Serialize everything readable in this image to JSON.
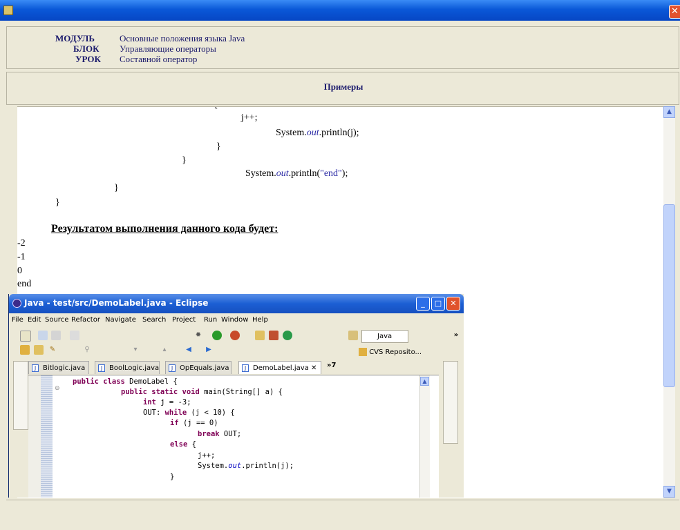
{
  "window": {
    "close_glyph": "✕"
  },
  "header": {
    "module_label": "МОДУЛЬ",
    "module_value": "Основные положения языка Java",
    "block_label": "БЛОК",
    "block_value": "Управляющие операторы",
    "lesson_label": "УРОК",
    "lesson_value": "Составной оператор"
  },
  "examples_title": "Примеры",
  "code": {
    "line_top": "{",
    "line1": "j++;",
    "line2a": "System.",
    "line2b": "out",
    "line2c": ".println(j);",
    "line3": "}",
    "line4": "}",
    "line5a": "System.",
    "line5b": "out",
    "line5c": ".println(",
    "line5d": "\"end\"",
    "line5e": ");",
    "line6": "}",
    "line7": "}"
  },
  "result_heading": "Результатом выполнения данного кода будет:",
  "output": [
    "-2",
    "-1",
    "0",
    "end"
  ],
  "eclipse": {
    "title": "Java - test/src/DemoLabel.java - Eclipse",
    "menu": [
      "File",
      "Edit",
      "Source",
      "Refactor",
      "Navigate",
      "Search",
      "Project",
      "Run",
      "Window",
      "Help"
    ],
    "perspective": "Java",
    "cvs": "CVS Reposito...",
    "overflow": "»",
    "tab_more": "»7",
    "tabs": [
      "Bitlogic.java",
      "BoolLogic.java",
      "OpEquals.java",
      "DemoLabel.java"
    ],
    "code": {
      "l1k": "public class",
      "l1t": " DemoLabel {",
      "l2k": "public static void",
      "l2t": " main(String[] a) {",
      "l3k": "int",
      "l3t": " j = -3;",
      "l4a": "OUT: ",
      "l4k": "while",
      "l4t": " (j < 10) {",
      "l5k": "if",
      "l5t": " (j == 0)",
      "l6k": "break",
      "l6t": " OUT;",
      "l7k": "else",
      "l7t": " {",
      "l8": "j++;",
      "l9a": "System.",
      "l9b": "out",
      "l9c": ".println(j);",
      "l10": "}"
    }
  },
  "colors": {
    "title_bar": "#0a58d8",
    "header_text": "#1b1a6c",
    "keyword": "#7f0055"
  }
}
